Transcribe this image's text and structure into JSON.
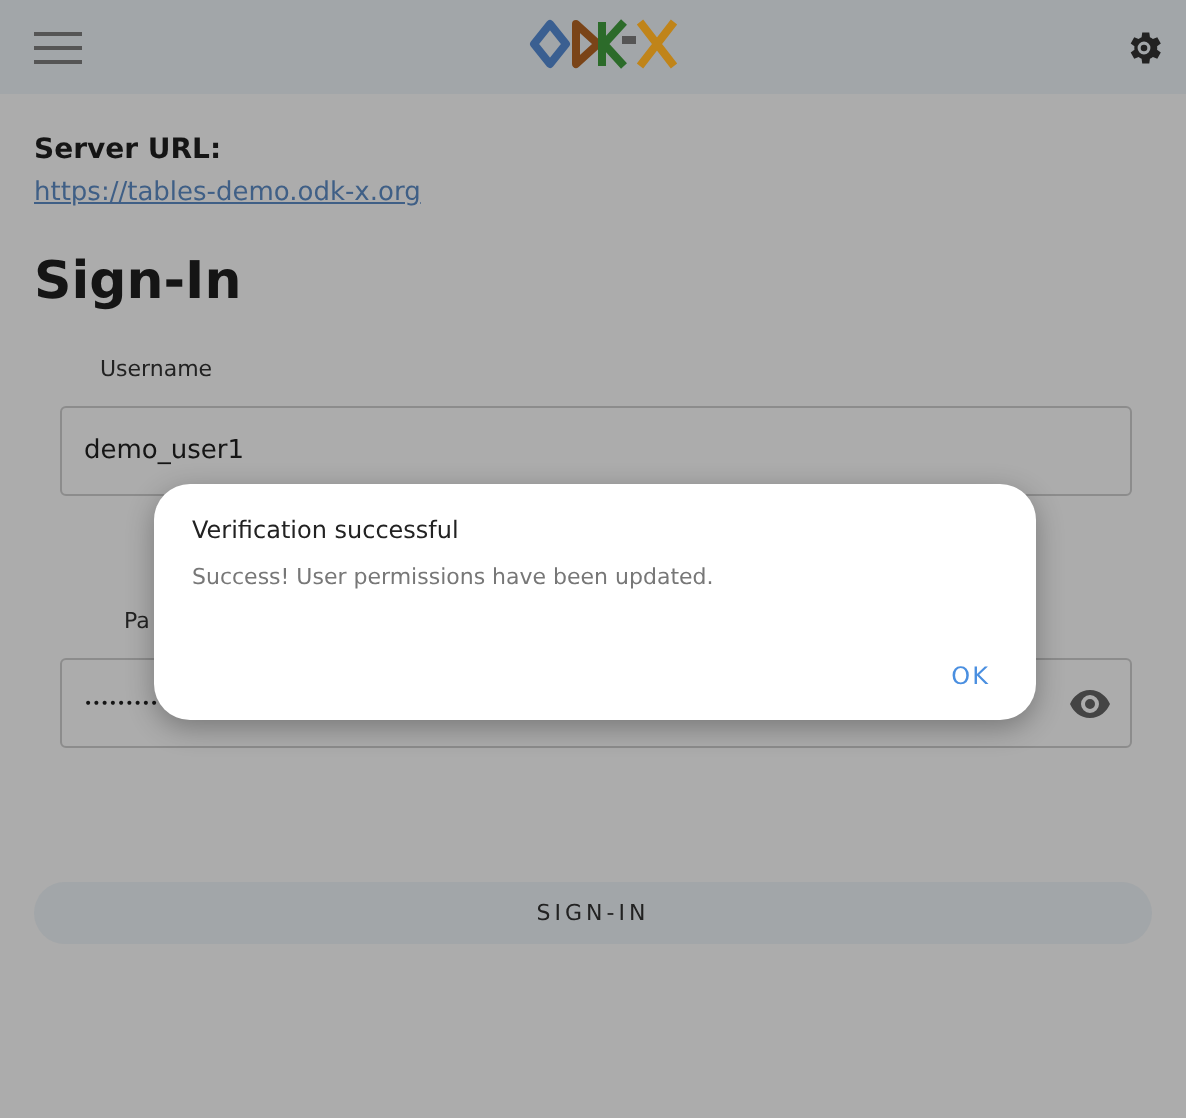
{
  "server": {
    "label": "Server URL:",
    "url": "https://tables-demo.odk-x.org"
  },
  "heading": "Sign-In",
  "fields": [
    {
      "kind": "text",
      "label": "Username",
      "value": "demo_user1"
    },
    {
      "kind": "password",
      "label": "Pa",
      "value": "•••••••••"
    }
  ],
  "sign_in_button": "SIGN-IN",
  "dialog": {
    "title": "Verification successful",
    "message": "Success! User permissions have been updated.",
    "button": "OK"
  }
}
